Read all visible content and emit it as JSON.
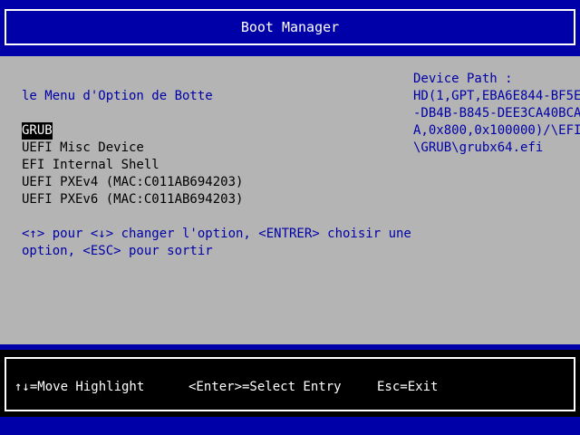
{
  "header": {
    "title": "Boot Manager"
  },
  "menu": {
    "heading": "le Menu d'Option de Botte",
    "items": [
      {
        "label": "GRUB",
        "selected": true
      },
      {
        "label": "UEFI Misc Device"
      },
      {
        "label": "EFI Internal Shell"
      },
      {
        "label": "UEFI PXEv4 (MAC:C011AB694203)"
      },
      {
        "label": "UEFI PXEv6 (MAC:C011AB694203)"
      }
    ],
    "instructions": [
      "<↑> pour <↓> changer l'option, <ENTRER> choisir une",
      "option, <ESC> pour sortir"
    ]
  },
  "device_path": {
    "label": "Device Path :",
    "lines": [
      "HD(1,GPT,EBA6E844-BF5E",
      "-DB4B-B845-DEE3CA40BCA",
      "A,0x800,0x100000)/\\EFI",
      "\\GRUB\\grubx64.efi"
    ]
  },
  "footer": {
    "move_hint": "↑↓=Move Highlight",
    "select_hint": "<Enter>=Select Entry",
    "exit_hint": "Esc=Exit"
  },
  "colors": {
    "background_blue": "#0000a8",
    "panel_gray": "#b4b4b4",
    "highlight": "#000000"
  }
}
